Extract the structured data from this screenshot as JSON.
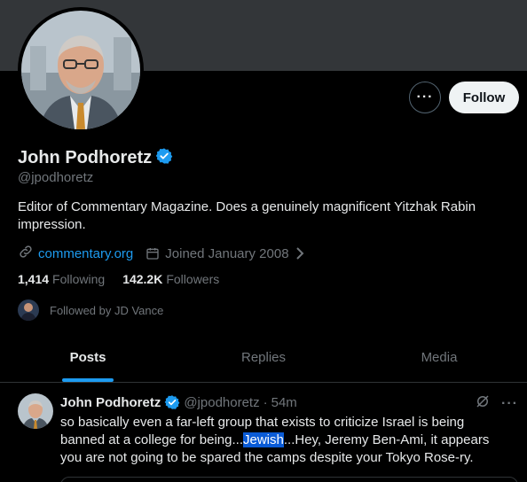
{
  "profile": {
    "name": "John Podhoretz",
    "handle": "@jpodhoretz",
    "bio": "Editor of Commentary Magazine. Does a genuinely magnificent Yitzhak Rabin impression.",
    "website": "commentary.org",
    "joined": "Joined January 2008",
    "following_count": "1,414",
    "following_label": "Following",
    "followers_count": "142.2K",
    "followers_label": "Followers",
    "followed_by": "Followed by JD Vance",
    "verified": true
  },
  "actions": {
    "more_icon": "more-icon",
    "follow_label": "Follow"
  },
  "tabs": [
    {
      "label": "Posts",
      "active": true
    },
    {
      "label": "Replies",
      "active": false
    },
    {
      "label": "Media",
      "active": false
    }
  ],
  "tweet": {
    "name": "John Podhoretz",
    "handle": "@jpodhoretz",
    "separator": "·",
    "time": "54m",
    "text_before": "so basically even a far-left group that exists to criticize Israel is being banned at a college for being...",
    "text_highlight": "Jewish",
    "text_after": "...Hey, Jeremy Ben-Ami, it appears you are not going to be spared the camps despite your Tokyo Rose-ry."
  },
  "colors": {
    "accent": "#1d9bf0",
    "background": "#000000",
    "banner": "#333639",
    "muted_text": "#71767b",
    "highlight": "#0a5bd6"
  }
}
